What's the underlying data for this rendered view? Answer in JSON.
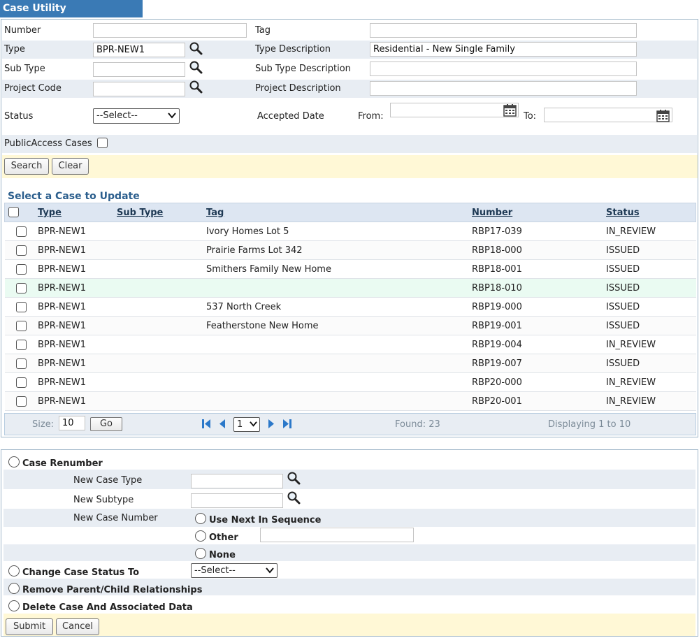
{
  "title": "Case Utility",
  "search": {
    "number_label": "Number",
    "number_value": "",
    "tag_label": "Tag",
    "tag_value": "",
    "type_label": "Type",
    "type_value": "BPR-NEW1",
    "type_desc_label": "Type Description",
    "type_desc_value": "Residential - New Single Family",
    "subtype_label": "Sub Type",
    "subtype_value": "",
    "subtype_desc_label": "Sub Type Description",
    "subtype_desc_value": "",
    "project_code_label": "Project Code",
    "project_code_value": "",
    "project_desc_label": "Project Description",
    "project_desc_value": "",
    "status_label": "Status",
    "status_value": "--Select--",
    "accepted_date_label": "Accepted Date",
    "from_label": "From:",
    "to_label": "To:",
    "public_access_label": "PublicAccess Cases",
    "search_button": "Search",
    "clear_button": "Clear"
  },
  "results": {
    "heading": "Select a Case to Update",
    "columns": [
      "Type",
      "Sub Type",
      "Tag",
      "Number",
      "Status"
    ],
    "rows": [
      {
        "type": "BPR-NEW1",
        "subtype": "",
        "tag": "Ivory Homes Lot 5",
        "number": "RBP17-039",
        "status": "IN_REVIEW"
      },
      {
        "type": "BPR-NEW1",
        "subtype": "",
        "tag": "Prairie Farms Lot 342",
        "number": "RBP18-000",
        "status": "ISSUED"
      },
      {
        "type": "BPR-NEW1",
        "subtype": "",
        "tag": "Smithers Family New Home",
        "number": "RBP18-001",
        "status": "ISSUED"
      },
      {
        "type": "BPR-NEW1",
        "subtype": "",
        "tag": "",
        "number": "RBP18-010",
        "status": "ISSUED"
      },
      {
        "type": "BPR-NEW1",
        "subtype": "",
        "tag": "537 North Creek",
        "number": "RBP19-000",
        "status": "ISSUED"
      },
      {
        "type": "BPR-NEW1",
        "subtype": "",
        "tag": "Featherstone New Home",
        "number": "RBP19-001",
        "status": "ISSUED"
      },
      {
        "type": "BPR-NEW1",
        "subtype": "",
        "tag": "",
        "number": "RBP19-004",
        "status": "IN_REVIEW"
      },
      {
        "type": "BPR-NEW1",
        "subtype": "",
        "tag": "",
        "number": "RBP19-007",
        "status": "ISSUED"
      },
      {
        "type": "BPR-NEW1",
        "subtype": "",
        "tag": "",
        "number": "RBP20-000",
        "status": "IN_REVIEW"
      },
      {
        "type": "BPR-NEW1",
        "subtype": "",
        "tag": "",
        "number": "RBP20-001",
        "status": "IN_REVIEW"
      }
    ],
    "pager": {
      "size_label": "Size:",
      "size_value": "10",
      "go_button": "Go",
      "page_value": "1",
      "found_text": "Found: 23",
      "displaying_text": "Displaying 1 to 10"
    }
  },
  "actions": {
    "case_renumber": "Case Renumber",
    "new_case_type_label": "New Case Type",
    "new_case_type_value": "",
    "new_subtype_label": "New Subtype",
    "new_subtype_value": "",
    "new_case_number_label": "New Case Number",
    "use_next_label": "Use Next In Sequence",
    "other_label": "Other",
    "other_value": "",
    "none_label": "None",
    "change_status_label": "Change Case Status To",
    "change_status_value": "--Select--",
    "remove_relationships_label": "Remove Parent/Child Relationships",
    "delete_case_label": "Delete Case And Associated Data",
    "submit_button": "Submit",
    "cancel_button": "Cancel"
  },
  "icons": {
    "lookup": "magnifier-icon",
    "calendar": "calendar-icon",
    "first": "first-page-icon",
    "prev": "prev-page-icon",
    "next": "next-page-icon",
    "last": "last-page-icon"
  },
  "colors": {
    "title_bar": "#3a7ab5",
    "band": "#e8edf3",
    "button_bar": "#fff8d6",
    "highlight_row": "#eafbf2",
    "heading": "#2b5e8d",
    "pager_icon": "#2b78c9"
  }
}
